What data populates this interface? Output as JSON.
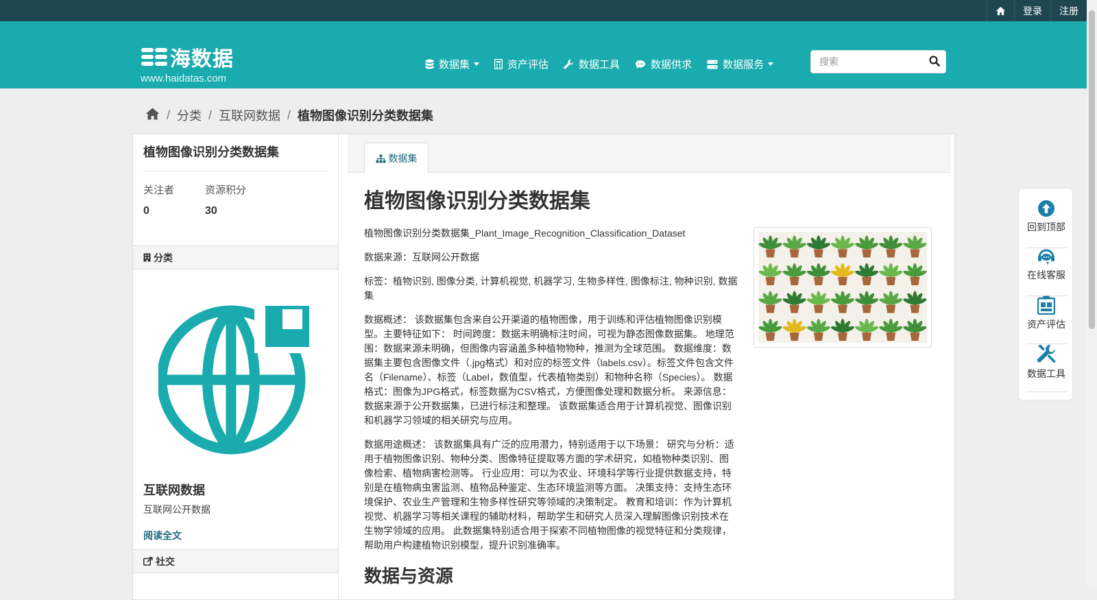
{
  "topbar": {
    "login": "登录",
    "register": "注册"
  },
  "brand": {
    "name": "海数据",
    "domain": "www.haidatas.com"
  },
  "nav": {
    "items": [
      {
        "label": "数据集",
        "icon": "database-icon",
        "dropdown": true
      },
      {
        "label": "资产评估",
        "icon": "calculator-icon",
        "dropdown": false
      },
      {
        "label": "数据工具",
        "icon": "wrench-icon",
        "dropdown": false
      },
      {
        "label": "数据供求",
        "icon": "comment-icon",
        "dropdown": false
      },
      {
        "label": "数据服务",
        "icon": "server-icon",
        "dropdown": true
      }
    ]
  },
  "search": {
    "placeholder": "搜索",
    "value": ""
  },
  "breadcrumb": {
    "items": [
      "分类",
      "互联网数据"
    ],
    "current": "植物图像识别分类数据集"
  },
  "sidebar": {
    "title": "植物图像识别分类数据集",
    "stats": [
      {
        "label": "关注者",
        "value": "0"
      },
      {
        "label": "资源积分",
        "value": "30"
      }
    ],
    "category_header": "分类",
    "org": {
      "name": "互联网数据",
      "desc": "互联网公开数据",
      "read_more": "阅读全文"
    },
    "social_header": "社交"
  },
  "tabs": {
    "active": "数据集"
  },
  "main": {
    "title": "植物图像识别分类数据集",
    "paragraphs": [
      "植物图像识别分类数据集_Plant_Image_Recognition_Classification_Dataset",
      "数据来源：互联网公开数据",
      "标签：植物识别, 图像分类, 计算机视觉, 机器学习, 生物多样性, 图像标注, 物种识别, 数据集",
      "数据概述： 该数据集包含来自公开渠道的植物图像，用于训练和评估植物图像识别模型。主要特征如下： 时间跨度：数据未明确标注时间，可视为静态图像数据集。 地理范围：数据来源未明确，但图像内容涵盖多种植物物种，推测为全球范围。 数据维度：数据集主要包含图像文件（.jpg格式）和对应的标签文件（labels.csv）。标签文件包含文件名（Filename）、标签（Label，数值型，代表植物类别）和物种名称（Species）。 数据格式：图像为JPG格式，标签数据为CSV格式，方便图像处理和数据分析。 来源信息：数据来源于公开数据集，已进行标注和整理。 该数据集适合用于计算机视觉、图像识别和机器学习领域的相关研究与应用。",
      "数据用途概述： 该数据集具有广泛的应用潜力，特别适用于以下场景： 研究与分析：适用于植物图像识别、物种分类、图像特征提取等方面的学术研究，如植物种类识别、图像检索、植物病害检测等。 行业应用：可以为农业、环境科学等行业提供数据支持，特别是在植物病虫害监测、植物品种鉴定、生态环境监测等方面。 决策支持：支持生态环境保护、农业生产管理和生物多样性研究等领域的决策制定。 教育和培训：作为计算机视觉、机器学习等相关课程的辅助材料，帮助学生和研究人员深入理解图像识别技术在生物学领域的应用。 此数据集特别适合用于探索不同植物图像的视觉特征和分类规律，帮助用户构建植物识别模型，提升识别准确率。"
    ],
    "section_title": "数据与资源"
  },
  "floatbar": {
    "items": [
      {
        "label": "回到顶部",
        "icon": "arrow-up-circle-icon"
      },
      {
        "label": "在线客服",
        "icon": "headset-icon"
      },
      {
        "label": "资产评估",
        "icon": "clipboard-icon"
      },
      {
        "label": "数据工具",
        "icon": "tools-icon"
      }
    ]
  },
  "colors": {
    "brand": "#1aabae",
    "topbar": "#1f4750",
    "link": "#1b6c80"
  }
}
